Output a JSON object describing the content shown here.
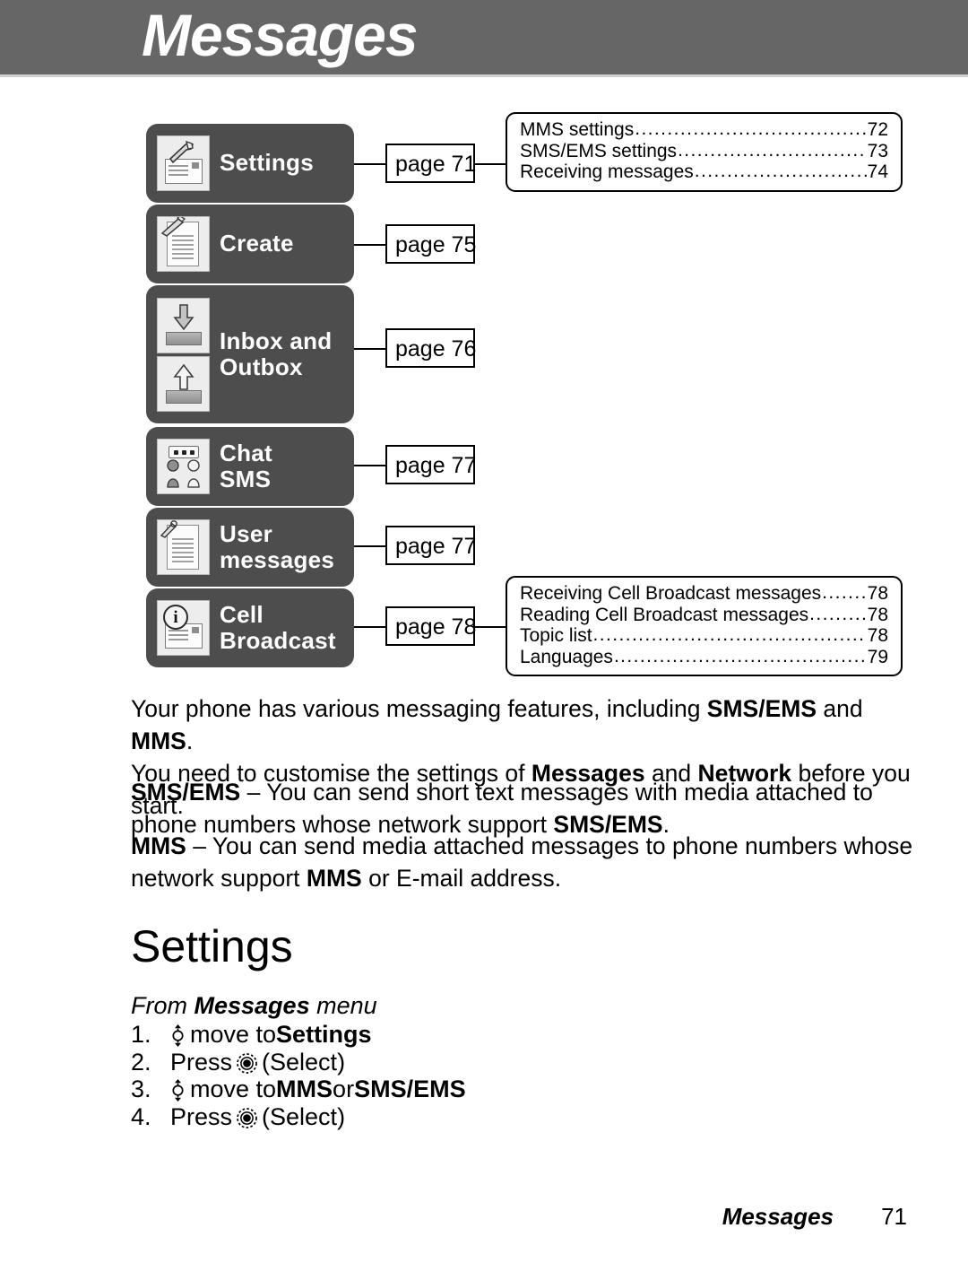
{
  "header": {
    "title": "Messages"
  },
  "menu": {
    "items": [
      {
        "label_lines": [
          "Settings"
        ],
        "icon": "settings-wrench-envelope-icon",
        "page_label": "page 71"
      },
      {
        "label_lines": [
          "Create"
        ],
        "icon": "create-pen-document-icon",
        "page_label": "page 75"
      },
      {
        "label_lines": [
          "Inbox and",
          "Outbox"
        ],
        "icon": "inbox-outbox-tray-arrows-icon",
        "page_label": "page 76"
      },
      {
        "label_lines": [
          "Chat",
          "SMS"
        ],
        "icon": "chat-sms-people-icon",
        "page_label": "page 77"
      },
      {
        "label_lines": [
          "User",
          "messages"
        ],
        "icon": "user-messages-document-icon",
        "page_label": "page 77"
      },
      {
        "label_lines": [
          "Cell",
          "Broadcast"
        ],
        "icon": "cell-broadcast-info-envelope-icon",
        "page_label": "page 78"
      }
    ]
  },
  "toc_settings": {
    "rows": [
      {
        "title": "MMS settings",
        "page": "72"
      },
      {
        "title": "SMS/EMS settings",
        "page": "73"
      },
      {
        "title": "Receiving messages",
        "page": "74"
      }
    ]
  },
  "toc_cell_broadcast": {
    "rows": [
      {
        "title": "Receiving Cell Broadcast messages",
        "page": "78"
      },
      {
        "title": "Reading Cell Broadcast messages",
        "page": "78"
      },
      {
        "title": "Topic list",
        "page": "78"
      },
      {
        "title": "Languages",
        "page": "79"
      }
    ]
  },
  "intro": {
    "line1_a": "Your phone has various messaging features, including ",
    "line1_b": "SMS/EMS",
    "line1_c": " and ",
    "line1_d": "MMS",
    "line1_e": ".",
    "line2_a": "You need to customise the settings of ",
    "line2_b": "Messages",
    "line2_c": " and ",
    "line2_d": "Network",
    "line2_e": " before you start."
  },
  "sms_para": {
    "term": "SMS/EMS",
    "dash": " – ",
    "text_a": "You can send short text messages with media attached to phone numbers whose network support ",
    "term2": "SMS/EMS",
    "text_b": "."
  },
  "mms_para": {
    "term": "MMS",
    "dash": " – ",
    "text_a": "You can send media attached messages to phone numbers whose network support ",
    "term2": "MMS",
    "text_b": " or E-mail address."
  },
  "settings_section": {
    "heading": "Settings",
    "from_a": "From ",
    "from_b": "Messages",
    "from_c": " menu",
    "steps": [
      {
        "num": "1.",
        "icon": "nav-updown-key-icon",
        "pre": "",
        "mid": "move to ",
        "bold": "Settings",
        "post": "",
        "bold2": "",
        "post2": ""
      },
      {
        "num": "2.",
        "icon": "select-key-icon",
        "pre": "Press ",
        "mid": "",
        "bold": "",
        "post": "(Select)",
        "bold2": "",
        "post2": ""
      },
      {
        "num": "3.",
        "icon": "nav-updown-key-icon",
        "pre": "",
        "mid": "move to ",
        "bold": "MMS",
        "post": " or ",
        "bold2": "SMS/EMS",
        "post2": ""
      },
      {
        "num": "4.",
        "icon": "select-key-icon",
        "pre": "Press ",
        "mid": "",
        "bold": "",
        "post": "(Select)",
        "bold2": "",
        "post2": ""
      }
    ]
  },
  "footer": {
    "label": "Messages",
    "page": "71"
  },
  "colors": {
    "header_bar": "#666666",
    "menu_box": "#4d4d4d",
    "text": "#000000",
    "page_bg": "#ffffff"
  }
}
